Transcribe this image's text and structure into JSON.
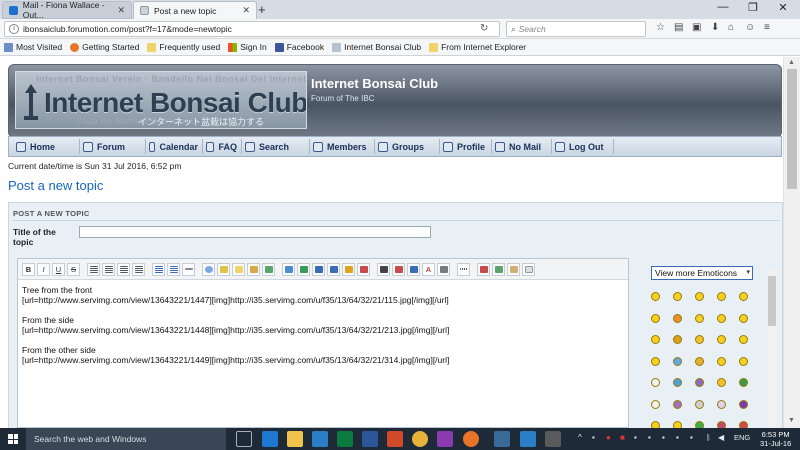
{
  "browser": {
    "tabs": [
      {
        "label": "Mail - Fiona Wallace - Out...",
        "active": false
      },
      {
        "label": "Post a new topic",
        "active": true
      }
    ],
    "new_tab": "+",
    "window_controls": [
      "—",
      "❐",
      "✕"
    ],
    "url": "ibonsaiclub.forumotion.com/post?f=17&mode=newtopic",
    "search_placeholder": "Search",
    "bookmarks": [
      "Most Visited",
      "Getting Started",
      "Frequently used",
      "Sign In",
      "Facebook",
      "Internet Bonsai Club",
      "From Internet Explorer"
    ]
  },
  "site": {
    "title": "Internet Bonsai Club",
    "subtitle": "Forum of The IBC",
    "logo_text": "Internet Bonsai Club",
    "logo_jp": "インターネット盆栽は協力する"
  },
  "menu": [
    "Home",
    "Forum",
    "Calendar",
    "FAQ",
    "Search",
    "Members",
    "Groups",
    "Profile",
    "No Mail",
    "Log Out"
  ],
  "datetime": "Current date/time is Sun 31 Jul 2016, 6:52 pm",
  "page_title": "Post a new topic",
  "form": {
    "section_header": "POST A NEW TOPIC",
    "title_label": "Title of the topic",
    "title_value": "",
    "toolbar": {
      "bold": "B",
      "italic": "I",
      "underline": "U",
      "strike": "S",
      "font_color": "A"
    },
    "editor_text": "Tree from the front\n[url=http://www.servimg.com/view/13643221/1447][img]http://i35.servimg.com/u/f35/13/64/32/21/115.jpg[/img][/url]\n\nFrom the side\n[url=http://www.servimg.com/view/13643221/1448][img]http://i35.servimg.com/u/f35/13/64/32/21/213.jpg[/img][/url]\n\nFrom the other side\n[url=http://www.servimg.com/view/13643221/1449][img]http://i35.servimg.com/u/f35/13/64/32/21/314.jpg[/img][/url]",
    "emoticons_select": "View more Emoticons"
  },
  "taskbar": {
    "search_placeholder": "Search the web and Windows",
    "lang": "ENG",
    "time": "6:53 PM",
    "date": "31-Jul-16"
  }
}
